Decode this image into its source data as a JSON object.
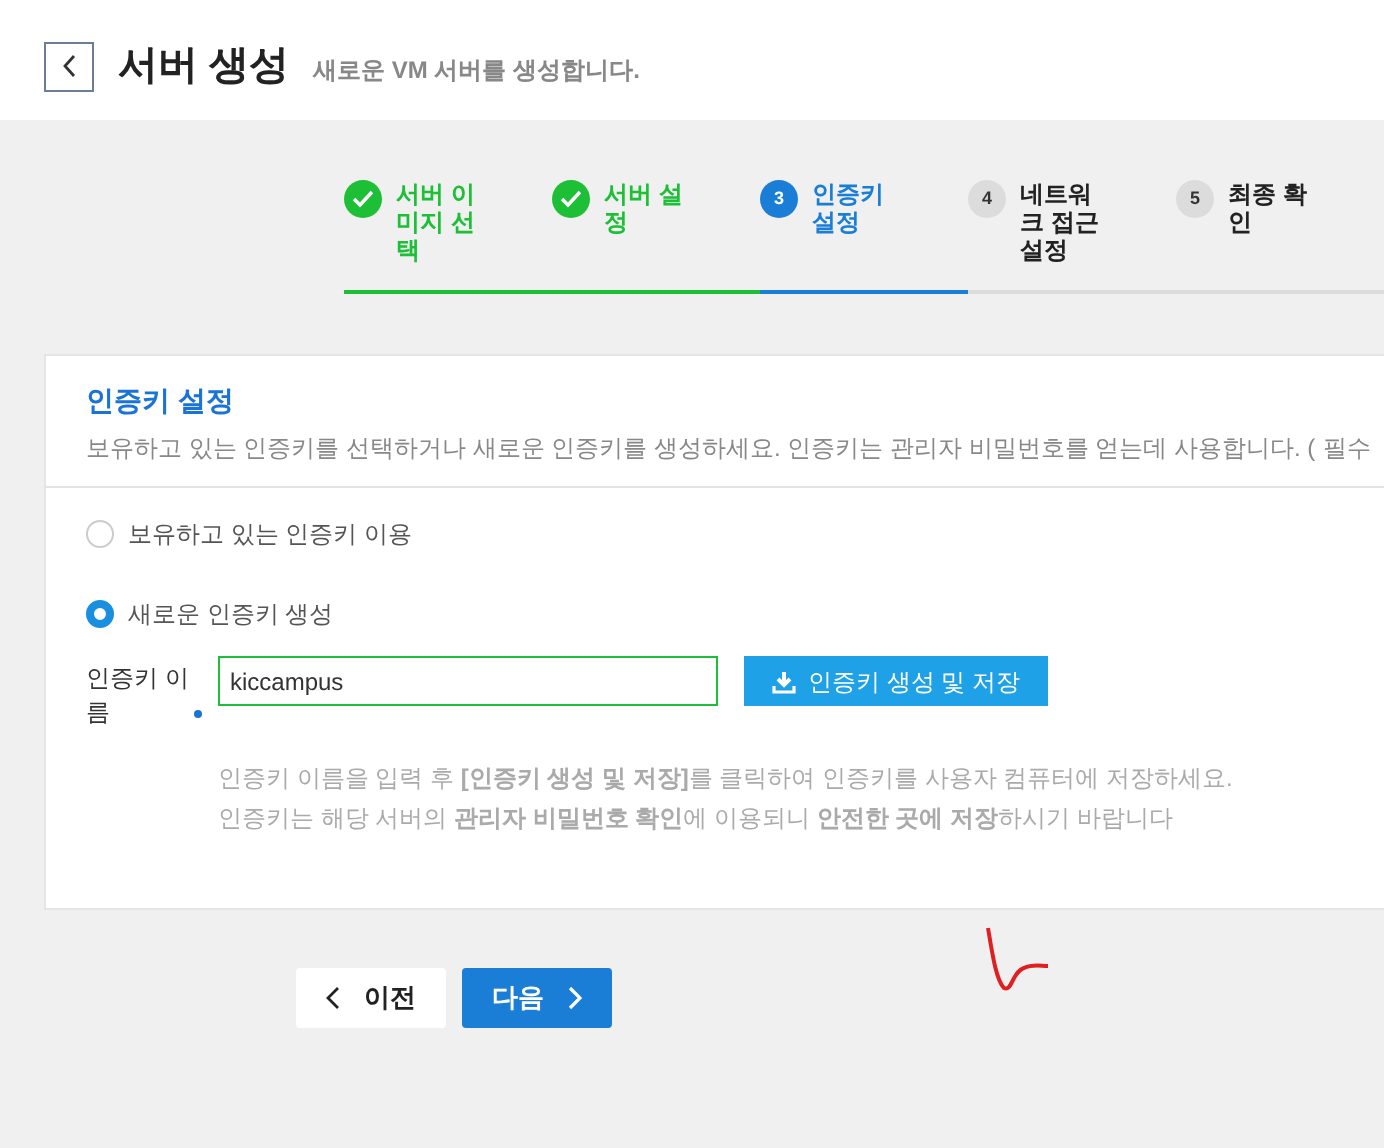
{
  "header": {
    "title": "서버 생성",
    "subtitle": "새로운 VM 서버를 생성합니다."
  },
  "steps": [
    {
      "label": "서버 이미지 선택",
      "done": true,
      "selected": false
    },
    {
      "label": "서버 설정",
      "done": true,
      "selected": false
    },
    {
      "number": "3",
      "label": "인증키 설정",
      "done": false,
      "selected": true
    },
    {
      "number": "4",
      "label": "네트워크 접근 설정",
      "done": false,
      "selected": false
    },
    {
      "number": "5",
      "label": "최종 확인",
      "done": false,
      "selected": false
    }
  ],
  "card": {
    "title": "인증키 설정",
    "description": "보유하고 있는 인증키를 선택하거나 새로운 인증키를 생성하세요. 인증키는 관리자 비밀번호를 얻는데 사용합니다. (",
    "required_note": "필수",
    "options": [
      {
        "label": "보유하고 있는 인증키 이용",
        "selected": false
      },
      {
        "label": "새로운 인증키 생성",
        "selected": true
      }
    ],
    "field": {
      "label": "인증키 이름",
      "value": "kiccampus",
      "button": "인증키 생성 및 저장"
    },
    "hints": [
      "인증키 이름을 입력 후 **[인증키 생성 및 저장]**를 클릭하여 인증키를 사용자 컴퓨터에 저장하세요.",
      "인증키는 해당 서버의 **관리자 비밀번호 확인**에 이용되니 **안전한 곳에 저장**하시기 바랍니다"
    ]
  },
  "buttons": {
    "prev": "이전",
    "next": "다음"
  }
}
